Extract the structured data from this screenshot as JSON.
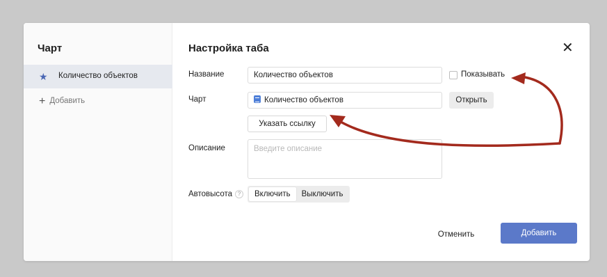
{
  "sidebar": {
    "title": "Чарт",
    "items": [
      {
        "label": "Количество объектов",
        "icon": "star-icon",
        "active": true
      }
    ],
    "add_label": "Добавить"
  },
  "dialog": {
    "title": "Настройка таба",
    "close_icon": "close-icon"
  },
  "form": {
    "name_label": "Название",
    "name_value": "Количество объектов",
    "show_label": "Показывать",
    "show_checked": false,
    "chart_label": "Чарт",
    "chart_value": "Количество объектов",
    "open_label": "Открыть",
    "link_label": "Указать ссылку",
    "description_label": "Описание",
    "description_placeholder": "Введите описание",
    "autoheight_label": "Автовысота",
    "help_glyph": "?",
    "autoheight_options": [
      "Включить",
      "Выключить"
    ],
    "autoheight_selected": "Включить"
  },
  "footer": {
    "cancel_label": "Отменить",
    "add_label": "Добавить"
  },
  "colors": {
    "accent": "#5b79c9",
    "annotation_arrow": "#a32a1d"
  }
}
